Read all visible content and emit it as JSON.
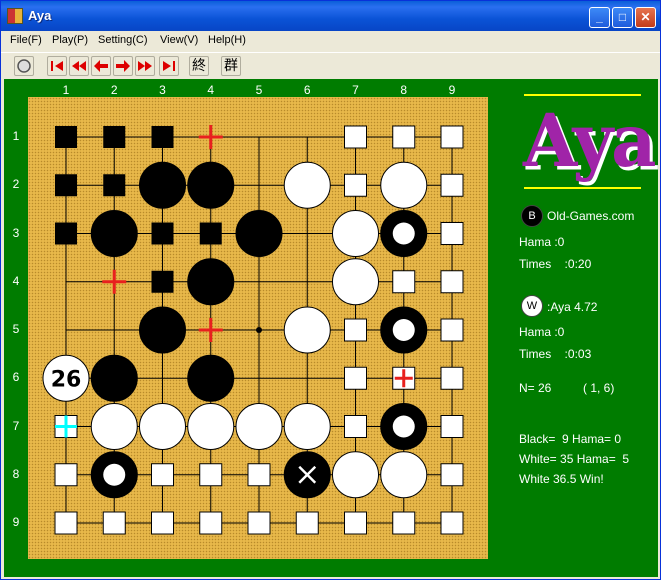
{
  "window": {
    "title": "Aya"
  },
  "menu": [
    "File(F)",
    "Play(P)",
    "Setting(C)",
    "View(V)",
    "Help(H)"
  ],
  "toolbar": {
    "kanji1": "終",
    "kanji2": "群"
  },
  "colors": {
    "green": "#007c00",
    "board": "#e8b84a",
    "logo": "#a024a8",
    "mark_red": "#e8201e",
    "mark_cyan": "#00ffff"
  },
  "board": {
    "size": 9,
    "col_labels": [
      "1",
      "2",
      "3",
      "4",
      "5",
      "6",
      "7",
      "8",
      "9"
    ],
    "row_labels": [
      "1",
      "2",
      "3",
      "4",
      "5",
      "6",
      "7",
      "8",
      "9"
    ],
    "stones": [
      {
        "c": 3,
        "r": 2,
        "color": "black"
      },
      {
        "c": 4,
        "r": 2,
        "color": "black"
      },
      {
        "c": 2,
        "r": 3,
        "color": "black"
      },
      {
        "c": 5,
        "r": 3,
        "color": "black"
      },
      {
        "c": 4,
        "r": 4,
        "color": "black"
      },
      {
        "c": 3,
        "r": 5,
        "color": "black"
      },
      {
        "c": 2,
        "r": 6,
        "color": "black"
      },
      {
        "c": 4,
        "r": 6,
        "color": "black"
      },
      {
        "c": 2,
        "r": 8,
        "color": "black",
        "mark": "white-dot"
      },
      {
        "c": 6,
        "r": 8,
        "color": "black",
        "mark": "x"
      },
      {
        "c": 8,
        "r": 3,
        "color": "black",
        "mark": "white-dot"
      },
      {
        "c": 8,
        "r": 5,
        "color": "black",
        "mark": "white-dot"
      },
      {
        "c": 8,
        "r": 7,
        "color": "black",
        "mark": "white-dot"
      },
      {
        "c": 6,
        "r": 2,
        "color": "white"
      },
      {
        "c": 8,
        "r": 2,
        "color": "white"
      },
      {
        "c": 7,
        "r": 3,
        "color": "white"
      },
      {
        "c": 7,
        "r": 4,
        "color": "white"
      },
      {
        "c": 6,
        "r": 5,
        "color": "white"
      },
      {
        "c": 2,
        "r": 7,
        "color": "white"
      },
      {
        "c": 3,
        "r": 7,
        "color": "white"
      },
      {
        "c": 4,
        "r": 7,
        "color": "white"
      },
      {
        "c": 5,
        "r": 7,
        "color": "white"
      },
      {
        "c": 6,
        "r": 7,
        "color": "white"
      },
      {
        "c": 7,
        "r": 8,
        "color": "white"
      },
      {
        "c": 8,
        "r": 8,
        "color": "white"
      },
      {
        "c": 1,
        "r": 6,
        "color": "white",
        "label": "26"
      }
    ],
    "black_territory": [
      [
        1,
        1
      ],
      [
        2,
        1
      ],
      [
        3,
        1
      ],
      [
        1,
        2
      ],
      [
        2,
        2
      ],
      [
        1,
        3
      ],
      [
        3,
        3
      ],
      [
        4,
        3
      ],
      [
        3,
        4
      ]
    ],
    "white_territory": [
      [
        7,
        1
      ],
      [
        8,
        1
      ],
      [
        9,
        1
      ],
      [
        7,
        2
      ],
      [
        9,
        2
      ],
      [
        9,
        3
      ],
      [
        8,
        4
      ],
      [
        9,
        4
      ],
      [
        7,
        5
      ],
      [
        9,
        5
      ],
      [
        7,
        6
      ],
      [
        9,
        6
      ],
      [
        7,
        7
      ],
      [
        9,
        7
      ],
      [
        1,
        8
      ],
      [
        3,
        8
      ],
      [
        4,
        8
      ],
      [
        5,
        8
      ],
      [
        9,
        8
      ],
      [
        1,
        9
      ],
      [
        2,
        9
      ],
      [
        3,
        9
      ],
      [
        4,
        9
      ],
      [
        5,
        9
      ],
      [
        6,
        9
      ],
      [
        7,
        9
      ],
      [
        8,
        9
      ],
      [
        9,
        9
      ]
    ],
    "red_crosses": [
      [
        4,
        1
      ],
      [
        2,
        4
      ],
      [
        4,
        5
      ]
    ],
    "red_cross_box": [
      8,
      6
    ],
    "cyan_cross_box": [
      1,
      7
    ],
    "star_point": [
      5,
      5
    ]
  },
  "info": {
    "black_name": "Old-Games.com",
    "black_badge": "B",
    "black_hama": "Hama :0",
    "black_times": "Times    :0:20",
    "white_name": ":Aya 4.72",
    "white_badge": "W",
    "white_hama": "Hama :0",
    "white_times": "Times    :0:03",
    "move_no": "N= 26",
    "move_pos": "( 1, 6)",
    "black_score": "Black=  9 Hama= 0",
    "white_score": "White= 35 Hama=  5",
    "result": "White 36.5 Win!"
  }
}
